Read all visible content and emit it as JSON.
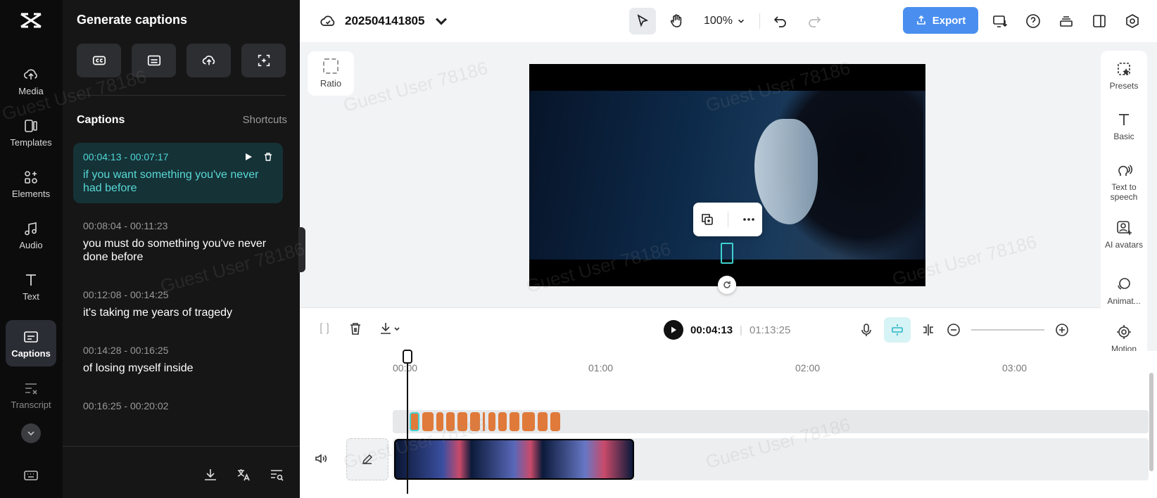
{
  "rail": {
    "items": [
      {
        "label": "Media",
        "icon": "cloud-upload-icon"
      },
      {
        "label": "Templates",
        "icon": "templates-icon"
      },
      {
        "label": "Elements",
        "icon": "elements-icon"
      },
      {
        "label": "Audio",
        "icon": "music-note-icon"
      },
      {
        "label": "Text",
        "icon": "text-t-icon"
      },
      {
        "label": "Captions",
        "icon": "captions-icon",
        "active": true
      },
      {
        "label": "Transcript",
        "icon": "transcript-icon"
      }
    ]
  },
  "panel": {
    "title": "Generate captions",
    "section_title": "Captions",
    "shortcuts_label": "Shortcuts",
    "captions": [
      {
        "time": "00:04:13 - 00:07:17",
        "text": "if you want something you've never had before",
        "active": true
      },
      {
        "time": "00:08:04 - 00:11:23",
        "text": "you must do something you've never done before"
      },
      {
        "time": "00:12:08 - 00:14:25",
        "text": "it's taking me years of tragedy"
      },
      {
        "time": "00:14:28 - 00:16:25",
        "text": "of losing myself inside"
      },
      {
        "time": "00:16:25 - 00:20:02",
        "text": ""
      }
    ]
  },
  "topbar": {
    "project_name": "202504141805",
    "zoom": "100%",
    "export_label": "Export"
  },
  "canvas": {
    "ratio_label": "Ratio"
  },
  "props": {
    "items": [
      {
        "label": "Presets",
        "icon": "presets-icon"
      },
      {
        "label": "Basic",
        "icon": "text-t-icon"
      },
      {
        "label": "Text to speech",
        "icon": "speech-icon"
      },
      {
        "label": "AI avatars",
        "icon": "avatar-icon"
      },
      {
        "label": "Animat...",
        "icon": "animation-icon"
      },
      {
        "label": "Motion tracking",
        "icon": "target-icon"
      }
    ]
  },
  "timeline": {
    "current_time": "00:04:13",
    "total_time": "01:13:25",
    "ticks": [
      "00:00",
      "01:00",
      "02:00",
      "03:00"
    ]
  },
  "watermark": "Guest User 78186",
  "colors": {
    "accent": "#4a8ff0",
    "caption_active": "#58d9d6",
    "caption_segment": "#e07a3a"
  }
}
